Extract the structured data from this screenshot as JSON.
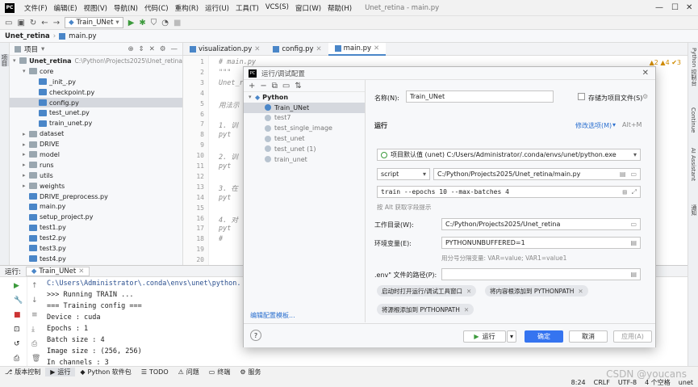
{
  "menubar": {
    "items": [
      "文件(F)",
      "编辑(E)",
      "视图(V)",
      "导航(N)",
      "代码(C)",
      "重构(R)",
      "运行(U)",
      "工具(T)",
      "VCS(S)",
      "窗口(W)",
      "帮助(H)"
    ],
    "window_title": "Unet_retina - main.py"
  },
  "toolbar": {
    "run_config": "Train_UNet"
  },
  "breadcrumb": {
    "project": "Unet_retina",
    "file": "main.py"
  },
  "leftstrip": {
    "project_tab": "项目",
    "bookmarks_tab": "书签",
    "structure_tab": "结构"
  },
  "project_panel": {
    "title": "项目",
    "root_name": "Unet_retina",
    "root_path": "C:\\Python\\Projects2025\\Unet_retina",
    "items": [
      {
        "label": "core",
        "kind": "folder",
        "level": 1,
        "expanded": true
      },
      {
        "label": "_init_.py",
        "kind": "py",
        "level": 2
      },
      {
        "label": "checkpoint.py",
        "kind": "py",
        "level": 2
      },
      {
        "label": "config.py",
        "kind": "py",
        "level": 2,
        "selected": true
      },
      {
        "label": "test_unet.py",
        "kind": "py",
        "level": 2
      },
      {
        "label": "train_unet.py",
        "kind": "py",
        "level": 2
      },
      {
        "label": "dataset",
        "kind": "folder",
        "level": 1
      },
      {
        "label": "DRIVE",
        "kind": "folder",
        "level": 1
      },
      {
        "label": "model",
        "kind": "folder",
        "level": 1
      },
      {
        "label": "runs",
        "kind": "folder",
        "level": 1
      },
      {
        "label": "utils",
        "kind": "folder",
        "level": 1
      },
      {
        "label": "weights",
        "kind": "folder",
        "level": 1
      },
      {
        "label": "DRIVE_preprocess.py",
        "kind": "py",
        "level": 1
      },
      {
        "label": "main.py",
        "kind": "py",
        "level": 1
      },
      {
        "label": "setup_project.py",
        "kind": "py",
        "level": 1
      },
      {
        "label": "test1.py",
        "kind": "py",
        "level": 1
      },
      {
        "label": "test2.py",
        "kind": "py",
        "level": 1
      },
      {
        "label": "test3.py",
        "kind": "py",
        "level": 1
      },
      {
        "label": "test4.py",
        "kind": "py",
        "level": 1
      }
    ]
  },
  "editor_tabs": [
    {
      "label": "visualization.py",
      "active": false
    },
    {
      "label": "config.py",
      "active": false
    },
    {
      "label": "main.py",
      "active": true
    }
  ],
  "editor": {
    "inspections": "▲2 ▲4 ✔3",
    "line_numbers": [
      "1",
      "2",
      "3",
      "4",
      "5",
      "6",
      "7",
      "8",
      "9",
      "10",
      "11",
      "12",
      "13",
      "14",
      "15",
      "16",
      "17",
      "18",
      "19",
      "20"
    ],
    "lines": [
      "# main.py",
      "\"\"\"",
      "Unet_r",
      "",
      "用法示",
      "",
      "1. 训",
      "    pyt",
      "",
      "2. 训",
      "    pyt",
      "",
      "3. 在",
      "    pyt",
      "",
      "4. 对",
      "    pyt",
      "    #",
      "",
      ""
    ]
  },
  "right_strip": {
    "tabs": [
      "Python 控制台",
      "Continue",
      "AI Assistant",
      "通知"
    ]
  },
  "run_panel": {
    "label": "运行:",
    "tab": "Train_UNet",
    "console": [
      "C:\\Users\\Administrator\\.conda\\envs\\unet\\python.",
      ">>> Running TRAIN ...",
      "=== Training config ===",
      "Device      : cuda",
      "Epochs      : 1",
      "Batch size  : 4",
      "Image size  : (256, 256)",
      "In channels : 3"
    ]
  },
  "statusbar": {
    "items": [
      "版本控制",
      "运行",
      "Python 软件包",
      "TODO",
      "问题",
      "终端",
      "服务"
    ]
  },
  "bottombar": {
    "position": "8:24",
    "line_sep": "CRLF",
    "encoding": "UTF-8",
    "indent": "4 个空格",
    "interpreter": "unet"
  },
  "watermark": "CSDN @youcans",
  "dialog": {
    "title": "运行/调试配置",
    "tree": {
      "group": "Python",
      "items": [
        {
          "label": "Train_UNet",
          "selected": true
        },
        {
          "label": "test7"
        },
        {
          "label": "test_single_image"
        },
        {
          "label": "test_unet"
        },
        {
          "label": "test_unet (1)"
        },
        {
          "label": "train_unet"
        }
      ],
      "edit_templates_link": "编辑配置模板..."
    },
    "name_label": "名称(N):",
    "name_value": "Train_UNet",
    "store_as_file": "存储为项目文件(S)",
    "run_section": "运行",
    "modify_options": "修改选项(M)",
    "modify_shortcut": "Alt+M",
    "interpreter": "项目默认值 (unet) C:/Users/Administrator/.conda/envs/unet/python.exe",
    "script_type": "script",
    "script_path": "C:/Python/Projects2025/Unet_retina/main.py",
    "params": "train --epochs 10 --max-batches 4",
    "params_hint": "按 Alt 获取字段提示",
    "workdir_label": "工作目录(W):",
    "workdir_value": "C:/Python/Projects2025/Unet_retina",
    "env_label": "环境变量(E):",
    "env_value": "PYTHONUNBUFFERED=1",
    "env_hint": "用分号分隔变量: VAR=value; VAR1=value1",
    "dotenv_label": ".env\" 文件的路径(P):",
    "chips": [
      "启动时打开运行/调试工具窗口",
      "将内容根添加到 PYTHONPATH",
      "将源根添加到 PYTHONPATH"
    ],
    "help": "?",
    "run_btn": "运行",
    "ok_btn": "确定",
    "cancel_btn": "取消",
    "apply_btn": "应用(A)"
  }
}
